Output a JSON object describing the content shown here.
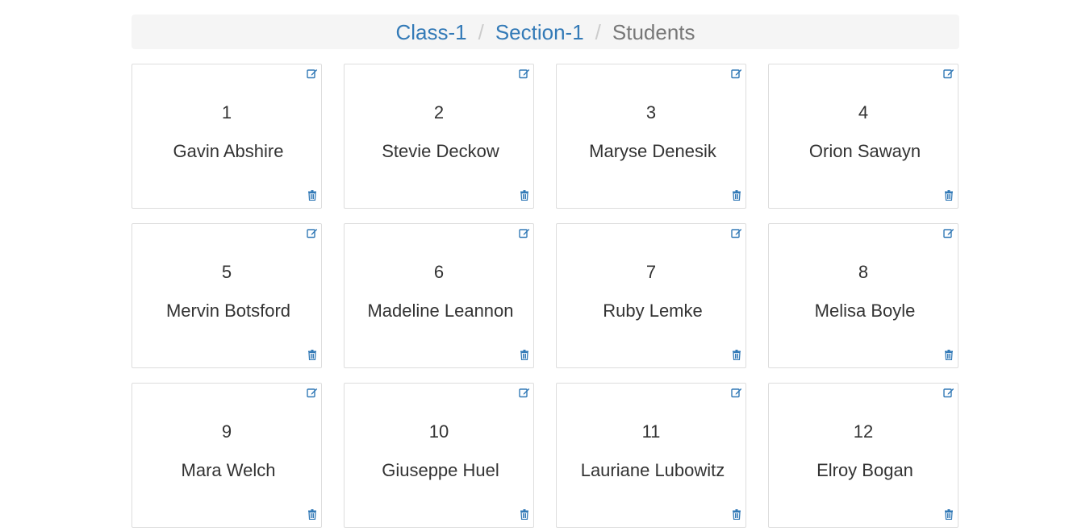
{
  "breadcrumb": {
    "items": [
      {
        "label": "Class-1",
        "link": true
      },
      {
        "label": "Section-1",
        "link": true
      },
      {
        "label": "Students",
        "link": false
      }
    ],
    "separator": "/"
  },
  "students": [
    {
      "number": "1",
      "name": "Gavin Abshire"
    },
    {
      "number": "2",
      "name": "Stevie Deckow"
    },
    {
      "number": "3",
      "name": "Maryse Denesik"
    },
    {
      "number": "4",
      "name": "Orion Sawayn"
    },
    {
      "number": "5",
      "name": "Mervin Botsford"
    },
    {
      "number": "6",
      "name": "Madeline Leannon"
    },
    {
      "number": "7",
      "name": "Ruby Lemke"
    },
    {
      "number": "8",
      "name": "Melisa Boyle"
    },
    {
      "number": "9",
      "name": "Mara Welch"
    },
    {
      "number": "10",
      "name": "Giuseppe Huel"
    },
    {
      "number": "11",
      "name": "Lauriane Lubowitz"
    },
    {
      "number": "12",
      "name": "Elroy Bogan"
    }
  ],
  "icons": {
    "edit": "edit-icon",
    "delete": "trash-icon"
  },
  "colors": {
    "link": "#337ab7",
    "active": "#777777",
    "breadcrumb_bg": "#f5f5f5",
    "card_border": "#dddddd",
    "text": "#333333"
  }
}
